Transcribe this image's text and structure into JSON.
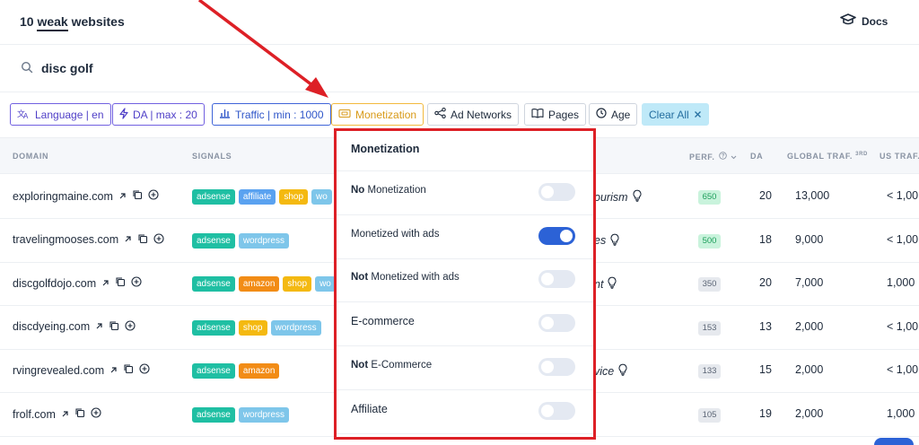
{
  "header": {
    "title_prefix": "10",
    "title_underlined": "weak",
    "title_suffix": "websites",
    "docs_label": "Docs"
  },
  "search": {
    "value": "disc golf"
  },
  "filters": {
    "language": "Language | en",
    "da": "DA | max : 20",
    "traffic": "Traffic | min : 1000",
    "monetization": "Monetization",
    "ad_networks": "Ad Networks",
    "pages": "Pages",
    "age": "Age",
    "clear_all": "Clear All"
  },
  "columns": {
    "domain": "DOMAIN",
    "signals": "SIGNALS",
    "perf": "PERF.",
    "da": "DA",
    "global_traffic": "GLOBAL TRAF.",
    "global_traffic_sup": "3RD",
    "us_traffic": "US TRAF."
  },
  "tag_colors": {
    "adsense": "#1fbfa3",
    "affiliate": "#5aa2f0",
    "shop": "#f4b911",
    "wordpress": "#7ec6ea",
    "amazon": "#f28c16"
  },
  "rows": [
    {
      "domain": "exploringmaine.com",
      "tags": [
        "adsense",
        "affiliate",
        "shop",
        "wo"
      ],
      "niche": "ourism",
      "perf": "650",
      "perf_style": "green",
      "da": "20",
      "global_traffic": "13,000",
      "us_traffic": "< 1,00"
    },
    {
      "domain": "travelingmooses.com",
      "tags": [
        "adsense",
        "wordpress"
      ],
      "niche": "es",
      "perf": "500",
      "perf_style": "green",
      "da": "18",
      "global_traffic": "9,000",
      "us_traffic": "< 1,00"
    },
    {
      "domain": "discgolfdojo.com",
      "tags": [
        "adsense",
        "amazon",
        "shop",
        "wo"
      ],
      "niche": "nt",
      "perf": "350",
      "perf_style": "gray",
      "da": "20",
      "global_traffic": "7,000",
      "us_traffic": "1,000"
    },
    {
      "domain": "discdyeing.com",
      "tags": [
        "adsense",
        "shop",
        "wordpress"
      ],
      "niche": "",
      "perf": "153",
      "perf_style": "gray",
      "da": "13",
      "global_traffic": "2,000",
      "us_traffic": "< 1,00"
    },
    {
      "domain": "rvingrevealed.com",
      "tags": [
        "adsense",
        "amazon"
      ],
      "niche": "vice",
      "perf": "133",
      "perf_style": "gray",
      "da": "15",
      "global_traffic": "2,000",
      "us_traffic": "< 1,00"
    },
    {
      "domain": "frolf.com",
      "tags": [
        "adsense",
        "wordpress"
      ],
      "niche": "",
      "perf": "105",
      "perf_style": "gray",
      "da": "19",
      "global_traffic": "2,000",
      "us_traffic": "1,000"
    }
  ],
  "dropdown": {
    "title": "Monetization",
    "options": [
      {
        "bold": "No",
        "rest": " Monetization",
        "on": false,
        "big": false
      },
      {
        "bold": "",
        "rest": "Monetized with ads",
        "on": true,
        "big": false
      },
      {
        "bold": "Not",
        "rest": " Monetized with ads",
        "on": false,
        "big": false
      },
      {
        "bold": "",
        "rest": "E-commerce",
        "on": false,
        "big": true
      },
      {
        "bold": "Not",
        "rest": " E-Commerce",
        "on": false,
        "big": false
      },
      {
        "bold": "",
        "rest": "Affiliate",
        "on": false,
        "big": true
      }
    ]
  },
  "colors": {
    "highlight_red": "#dd2026",
    "toggle_on": "#2c62d6",
    "toggle_off": "#e4e9f2"
  }
}
